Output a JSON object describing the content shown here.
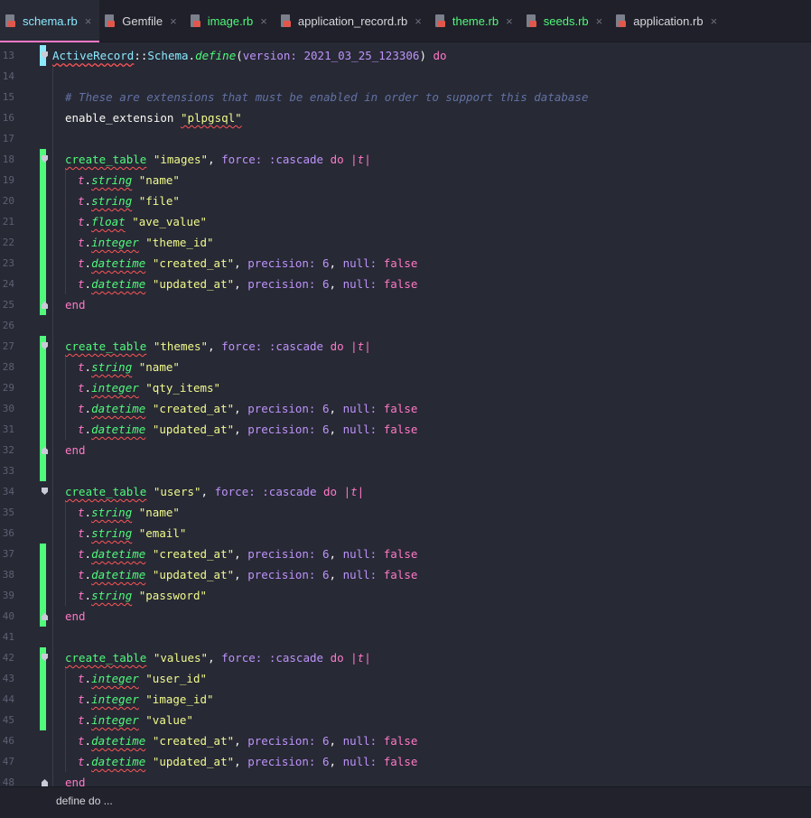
{
  "tabs": [
    {
      "label": "schema.rb",
      "color": "cyan",
      "active": true
    },
    {
      "label": "Gemfile",
      "color": "plain",
      "active": false
    },
    {
      "label": "image.rb",
      "color": "green",
      "active": false
    },
    {
      "label": "application_record.rb",
      "color": "plain",
      "active": false
    },
    {
      "label": "theme.rb",
      "color": "green",
      "active": false
    },
    {
      "label": "seeds.rb",
      "color": "green",
      "active": false
    },
    {
      "label": "application.rb",
      "color": "plain",
      "active": false
    }
  ],
  "tab_close_glyph": "×",
  "gutter_colors": {
    "modified": "#50fa7b",
    "current": "#8be9fd"
  },
  "line_numbers": [
    "13",
    "14",
    "15",
    "16",
    "17",
    "18",
    "19",
    "20",
    "21",
    "22",
    "23",
    "24",
    "25",
    "26",
    "27",
    "28",
    "29",
    "30",
    "31",
    "32",
    "33",
    "34",
    "35",
    "36",
    "37",
    "38",
    "39",
    "40",
    "41",
    "42",
    "43",
    "44",
    "45",
    "46",
    "47",
    "48"
  ],
  "code": {
    "l13": {
      "a": "ActiveRecord",
      "b": "::",
      "c": "Schema",
      "d": ".",
      "e": "define",
      "f": "(",
      "g": "version:",
      "h": " 2021_03_25_123306",
      "i": ")",
      "j": " do"
    },
    "l15": "# These are extensions that must be enabled in order to support this database",
    "l16": {
      "a": "enable_extension ",
      "b": "\"plpgsql\""
    },
    "tables": [
      {
        "name": "\"images\"",
        "cols": [
          {
            "type": "string",
            "name": "\"name\""
          },
          {
            "type": "string",
            "name": "\"file\""
          },
          {
            "type": "float",
            "name": "\"ave_value\""
          },
          {
            "type": "integer",
            "name": "\"theme_id\""
          },
          {
            "type": "datetime",
            "name": "\"created_at\"",
            "opts": true
          },
          {
            "type": "datetime",
            "name": "\"updated_at\"",
            "opts": true
          }
        ]
      },
      {
        "name": "\"themes\"",
        "cols": [
          {
            "type": "string",
            "name": "\"name\""
          },
          {
            "type": "integer",
            "name": "\"qty_items\""
          },
          {
            "type": "datetime",
            "name": "\"created_at\"",
            "opts": true
          },
          {
            "type": "datetime",
            "name": "\"updated_at\"",
            "opts": true
          }
        ]
      },
      {
        "name": "\"users\"",
        "cols": [
          {
            "type": "string",
            "name": "\"name\""
          },
          {
            "type": "string",
            "name": "\"email\""
          },
          {
            "type": "datetime",
            "name": "\"created_at\"",
            "opts": true
          },
          {
            "type": "datetime",
            "name": "\"updated_at\"",
            "opts": true
          },
          {
            "type": "string",
            "name": "\"password\""
          }
        ]
      },
      {
        "name": "\"values\"",
        "cols": [
          {
            "type": "integer",
            "name": "\"user_id\""
          },
          {
            "type": "integer",
            "name": "\"image_id\""
          },
          {
            "type": "integer",
            "name": "\"value\""
          },
          {
            "type": "datetime",
            "name": "\"created_at\"",
            "opts": true
          },
          {
            "type": "datetime",
            "name": "\"updated_at\"",
            "opts": true
          }
        ]
      }
    ],
    "tokens": {
      "create_table": "create_table",
      "force": "force:",
      "cascade": ":cascade",
      "do": "do",
      "pipe_t": "|t|",
      "t": "t",
      "dot": ".",
      "comma": ",",
      "precision": "precision:",
      "six": "6",
      "null": "null:",
      "false": "false",
      "end": "end"
    }
  },
  "statusbar": {
    "breadcrumb": "define do ..."
  }
}
